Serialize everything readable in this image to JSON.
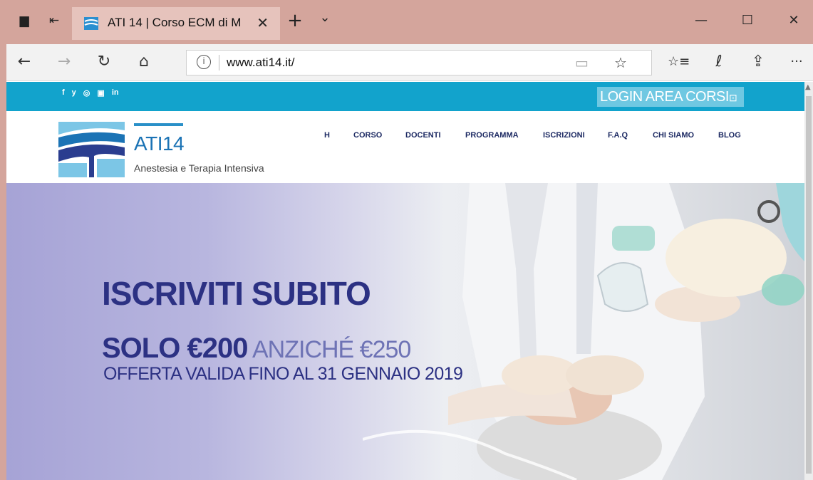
{
  "browser": {
    "tab": {
      "title": "ATI 14 | Corso ECM di M",
      "close": "✕"
    },
    "new_tab": "+",
    "tab_list": "⌄",
    "window": {
      "minimize": "—",
      "maximize": "☐",
      "close": "✕"
    },
    "nav": {
      "back": "←",
      "forward": "→",
      "refresh": "↻",
      "home": "⌂"
    },
    "url": "www.ati14.it/",
    "url_info": "i",
    "reading_view": "▭",
    "favorite": "☆",
    "favorites_hub": "☆≡",
    "notes": "ℓ",
    "share": "⇪",
    "more": "···"
  },
  "site": {
    "social": [
      "f",
      "y",
      "◎",
      "▣",
      "in"
    ],
    "login": "LOGIN AREA CORSI",
    "login_icon": "🔒",
    "logo_title": "ATI14",
    "logo_subtitle": "Anestesia e Terapia Intensiva",
    "menu": [
      "H",
      "CORSO",
      "DOCENTI",
      "PROGRAMMA",
      "ISCRIZIONI",
      "F.A.Q",
      "CHI SIAMO",
      "BLOG"
    ]
  },
  "hero": {
    "headline": "ISCRIVITI SUBITO",
    "price_bold": "SOLO €200",
    "price_light": " ANZICHÉ €250",
    "offer": "OFFERTA VALIDA FINO AL 31 GENNAIO  2019"
  },
  "colors": {
    "titlebar": "#d4a59c",
    "topstrip": "#12a3cc",
    "brand_blue": "#1b73b5",
    "hero_text": "#2c3183"
  }
}
